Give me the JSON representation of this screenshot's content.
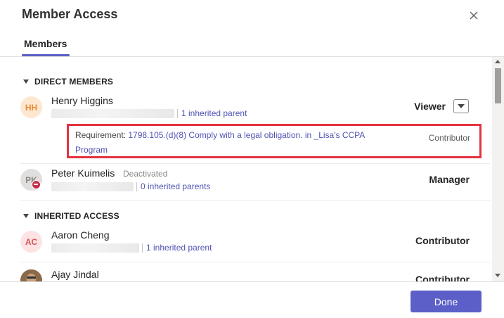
{
  "dialog": {
    "title": "Member Access",
    "close_icon": "close-icon"
  },
  "tabs": [
    {
      "label": "Members",
      "selected": true
    }
  ],
  "sections": {
    "direct_members": "DIRECT MEMBERS",
    "inherited_access": "INHERITED ACCESS"
  },
  "members": {
    "henry": {
      "initials": "HH",
      "name": "Henry Higgins",
      "inherited": "1 inherited parent",
      "role": "Viewer",
      "requirement": {
        "prefix": "Requirement: ",
        "link": "1798.105.(d)(8) Comply with a legal obligation. in _Lisa's CCPA Program",
        "role": "Contributor"
      }
    },
    "peter": {
      "initials": "PK",
      "name": "Peter Kuimelis",
      "status": "Deactivated",
      "inherited": "0 inherited parents",
      "role": "Manager"
    },
    "aaron": {
      "initials": "AC",
      "name": "Aaron Cheng",
      "inherited": "1 inherited parent",
      "role": "Contributor"
    },
    "ajay": {
      "name": "Ajay Jindal",
      "role": "Contributor"
    }
  },
  "footer": {
    "done_label": "Done"
  },
  "colors": {
    "accent": "#5b5fc7",
    "link": "#4f52b2",
    "highlight": "#e5323e",
    "deactivated_badge": "#c4314b"
  }
}
